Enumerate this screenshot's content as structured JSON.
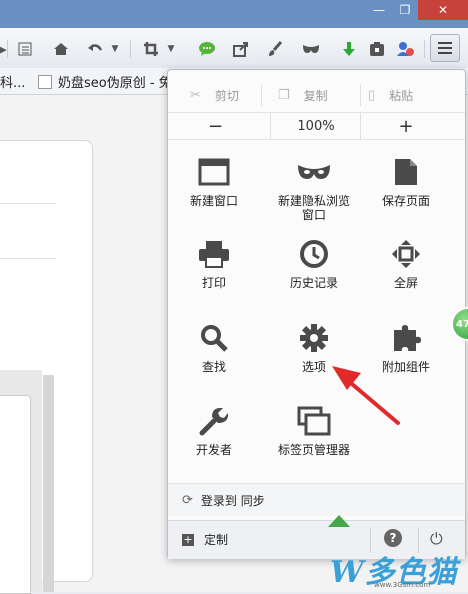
{
  "browser": {
    "window_buttons": {
      "minimize": "—",
      "maximize": "❐",
      "close": "✕"
    },
    "toolbar_icons": [
      "list-icon",
      "home-icon",
      "undo-icon",
      "crop-icon",
      "chat-icon",
      "share-icon",
      "brush-icon",
      "mask-icon",
      "download-icon",
      "save-icon",
      "person-icon"
    ],
    "bookmarks": [
      "科...",
      "奶盘seo伪原创 - 免"
    ]
  },
  "menu": {
    "edit": {
      "cut": "剪切",
      "copy": "复制",
      "paste": "粘贴"
    },
    "zoom": {
      "minus": "−",
      "level": "100%",
      "plus": "+"
    },
    "tiles": [
      {
        "label": "新建窗口",
        "icon": "new-window-icon"
      },
      {
        "label": "新建隐私浏览窗口",
        "icon": "private-mask-icon"
      },
      {
        "label": "保存页面",
        "icon": "save-page-icon"
      },
      {
        "label": "打印",
        "icon": "printer-icon"
      },
      {
        "label": "历史记录",
        "icon": "history-clock-icon"
      },
      {
        "label": "全屏",
        "icon": "fullscreen-icon"
      },
      {
        "label": "查找",
        "icon": "search-icon"
      },
      {
        "label": "选项",
        "icon": "gear-icon"
      },
      {
        "label": "附加组件",
        "icon": "puzzle-icon"
      },
      {
        "label": "开发者",
        "icon": "wrench-icon"
      },
      {
        "label": "标签页管理器",
        "icon": "tab-manager-icon"
      }
    ],
    "sync_label": "登录到 同步",
    "customize_label": "定制",
    "help_icon": "?",
    "power_icon": "⏻"
  },
  "badge_text": "47",
  "watermark": {
    "text": "W多色猫",
    "url": "www.3Gsm.com"
  },
  "colors": {
    "titlebar": "#6a8fc2",
    "close": "#c7423a",
    "arrow": "#e02a2a",
    "gray_icon": "#4a4a4a"
  }
}
